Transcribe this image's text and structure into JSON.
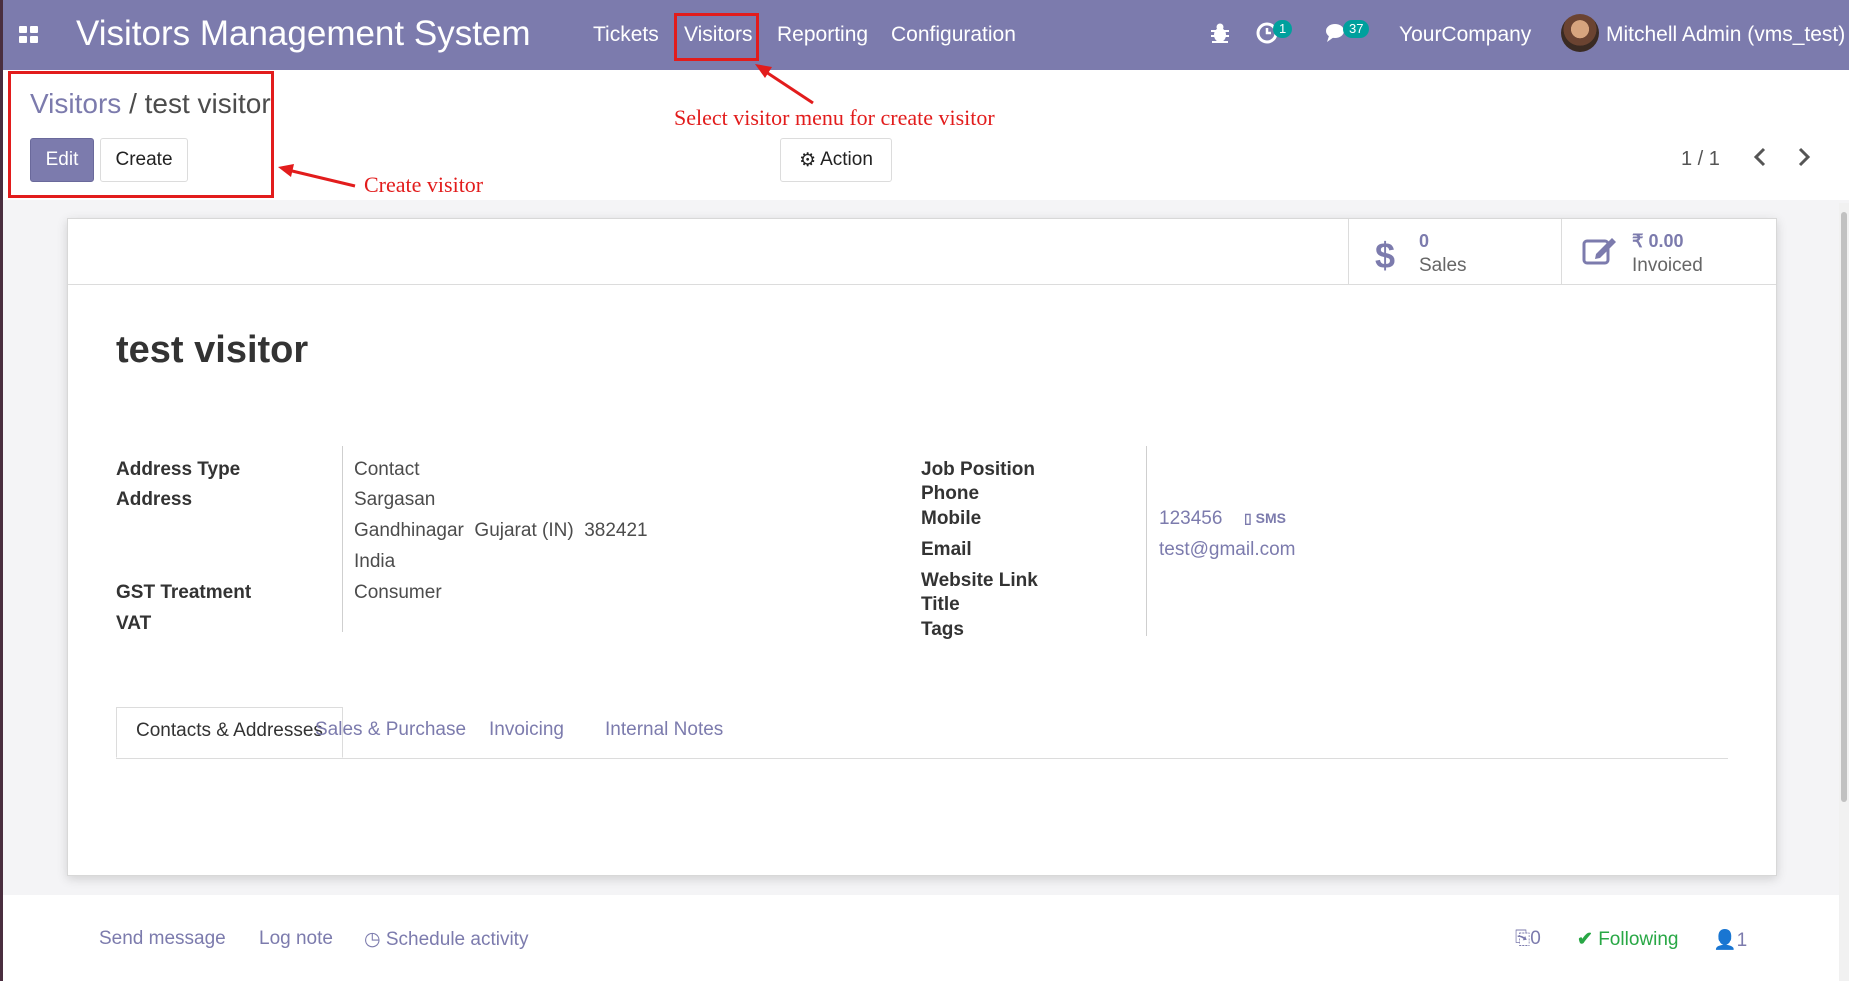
{
  "navbar": {
    "brand": "Visitors Management System",
    "menu": [
      "Tickets",
      "Visitors",
      "Reporting",
      "Configuration"
    ],
    "activity_count": "1",
    "message_count": "37",
    "company": "YourCompany",
    "user": "Mitchell Admin (vms_test)"
  },
  "breadcrumb": {
    "parent": "Visitors",
    "separator": "/",
    "current": "test visitor"
  },
  "buttons": {
    "edit": "Edit",
    "create": "Create",
    "action": "Action"
  },
  "pager": {
    "value": "1 / 1"
  },
  "annotations": {
    "visitor_menu": "Select visitor menu for create visitor",
    "create_visitor": "Create visitor"
  },
  "stats": {
    "sales": {
      "value": "0",
      "label": "Sales"
    },
    "invoiced": {
      "value": "₹ 0.00",
      "label": "Invoiced"
    }
  },
  "record": {
    "name": "test visitor",
    "left_labels": {
      "address_type": "Address Type",
      "address": "Address",
      "gst_treatment": "GST Treatment",
      "vat": "VAT"
    },
    "left_values": {
      "address_type": "Contact",
      "street": "Sargasan",
      "city_line": "Gandhinagar  Gujarat (IN)  382421",
      "country": "India",
      "gst_treatment": "Consumer"
    },
    "right_labels": {
      "job_position": "Job Position",
      "phone": "Phone",
      "mobile": "Mobile",
      "email": "Email",
      "website": "Website Link",
      "title": "Title",
      "tags": "Tags"
    },
    "right_values": {
      "mobile": "123456",
      "sms": "SMS",
      "email": "test@gmail.com"
    }
  },
  "tabs": [
    "Contacts & Addresses",
    "Sales & Purchase",
    "Invoicing",
    "Internal Notes"
  ],
  "chatter": {
    "send_message": "Send message",
    "log_note": "Log note",
    "schedule_activity": "Schedule activity",
    "attachments": "0",
    "following": "Following",
    "followers": "1"
  },
  "colors": {
    "primary": "#7c7bad",
    "annotation": "#e21c1c",
    "badge": "#00a09d",
    "following": "#28a745"
  }
}
